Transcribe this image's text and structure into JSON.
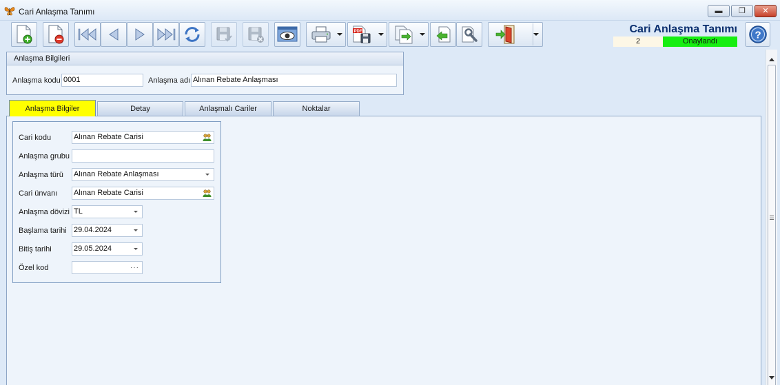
{
  "window": {
    "title": "Cari Anlaşma Tanımı",
    "icon": "butterfly-icon"
  },
  "toolbar": {
    "buttons": [
      {
        "icon": "new-document-icon"
      },
      {
        "icon": "delete-document-icon"
      },
      {
        "icon": "first-record-icon"
      },
      {
        "icon": "previous-record-icon"
      },
      {
        "icon": "next-record-icon"
      },
      {
        "icon": "last-record-icon"
      },
      {
        "icon": "refresh-icon"
      },
      {
        "icon": "save-icon",
        "disabled": true
      },
      {
        "icon": "save-cancel-icon",
        "disabled": true
      },
      {
        "icon": "preview-icon"
      },
      {
        "icon": "print-icon"
      },
      {
        "icon": "pdf-export-icon"
      },
      {
        "icon": "transfer-icon"
      },
      {
        "icon": "import-icon"
      },
      {
        "icon": "tools-icon"
      },
      {
        "icon": "exit-door-icon"
      }
    ]
  },
  "header": {
    "form_title": "Cari Anlaşma Tanımı",
    "record_number": "2",
    "status": "Onaylandı",
    "status_color": "#17ee11"
  },
  "agreement_info": {
    "group_title": "Anlaşma Bilgileri",
    "code_label": "Anlaşma kodu",
    "code_value": "0001",
    "name_label": "Anlaşma adı",
    "name_value": "Alınan Rebate Anlaşması"
  },
  "tabs": [
    {
      "label": "Anlaşma Bilgiler",
      "active": true
    },
    {
      "label": "Detay",
      "active": false
    },
    {
      "label": "Anlaşmalı Cariler",
      "active": false
    },
    {
      "label": "Noktalar",
      "active": false
    }
  ],
  "details": {
    "fields": [
      {
        "label": "Cari kodu",
        "value": "Alınan Rebate Carisi",
        "type": "lookup"
      },
      {
        "label": "Anlaşma grubu",
        "value": "",
        "type": "text"
      },
      {
        "label": "Anlaşma türü",
        "value": "Alınan Rebate Anlaşması",
        "type": "combo"
      },
      {
        "label": "Cari ünvanı",
        "value": "Alınan Rebate Carisi",
        "type": "lookup"
      },
      {
        "label": "Anlaşma dövizi",
        "value": "TL",
        "type": "combo"
      },
      {
        "label": "Başlama tarihi",
        "value": "29.04.2024",
        "type": "date"
      },
      {
        "label": "Bitiş tarihi",
        "value": "29.05.2024",
        "type": "date"
      },
      {
        "label": "Özel kod",
        "value": "",
        "type": "ellipsis",
        "ellipsis": "···"
      }
    ]
  },
  "colors": {
    "active_tab": "#ffff00",
    "heading": "#0a2e6e"
  }
}
